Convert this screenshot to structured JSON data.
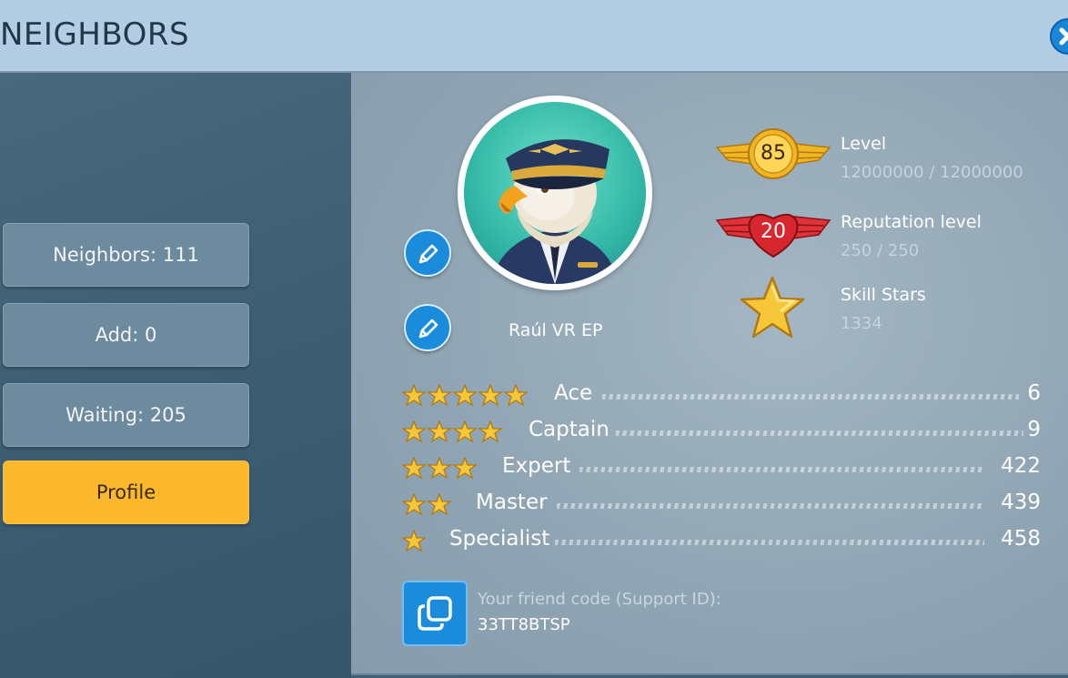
{
  "header": {
    "title": "NEIGHBORS"
  },
  "sidebar": {
    "items": [
      {
        "label": "Neighbors: 111"
      },
      {
        "label": "Add: 0"
      },
      {
        "label": "Waiting: 205"
      },
      {
        "label": "Profile"
      }
    ]
  },
  "profile": {
    "player_name": "Raúl VR EP",
    "level": {
      "badge": "85",
      "label": "Level",
      "value": "12000000 / 12000000"
    },
    "reputation": {
      "badge": "20",
      "label": "Reputation level",
      "value": "250 / 250"
    },
    "skill_stars": {
      "label": "Skill Stars",
      "value": "1334"
    },
    "ranks": [
      {
        "name": "Ace",
        "count": "6",
        "stars": 5
      },
      {
        "name": "Captain",
        "count": "9",
        "stars": 4
      },
      {
        "name": "Expert",
        "count": "422",
        "stars": 3
      },
      {
        "name": "Master",
        "count": "439",
        "stars": 2
      },
      {
        "name": "Specialist",
        "count": "458",
        "stars": 1
      }
    ],
    "friend_code": {
      "label": "Your friend code (Support ID):",
      "value": "33TT8BTSP"
    }
  },
  "colors": {
    "header_bg": "#b3cee4",
    "active_tab": "#fbb82d",
    "accent_blue": "#1b8cdc",
    "gold": "#f6c739",
    "red": "#d8262e"
  },
  "icons": {
    "close": "close-icon",
    "edit": "pencil-icon",
    "copy": "copy-icon",
    "level": "level-wings-icon",
    "reputation": "heart-wings-icon",
    "skill": "star-icon"
  }
}
